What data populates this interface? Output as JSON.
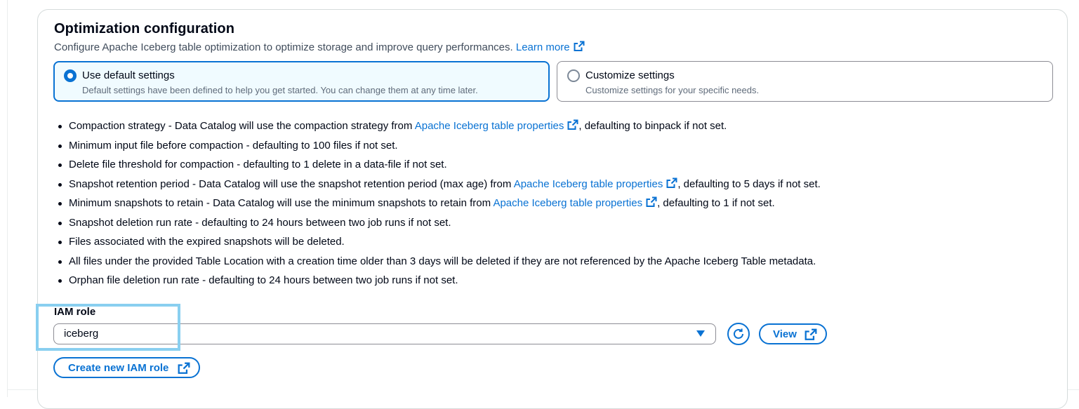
{
  "section": {
    "title": "Optimization configuration",
    "description": "Configure Apache Iceberg table optimization to optimize storage and improve query performances.",
    "learn_more": "Learn more"
  },
  "options": [
    {
      "label": "Use default settings",
      "description": "Default settings have been defined to help you get started. You can change them at any time later.",
      "selected": true
    },
    {
      "label": "Customize settings",
      "description": "Customize settings for your specific needs.",
      "selected": false
    }
  ],
  "bullets": [
    {
      "before": "Compaction strategy - Data Catalog will use the compaction strategy from ",
      "link": "Apache Iceberg table properties",
      "after": ", defaulting to binpack if not set."
    },
    {
      "before": "Minimum input file before compaction - defaulting to 100 files if not set.",
      "link": "",
      "after": ""
    },
    {
      "before": "Delete file threshold for compaction - defaulting to 1 delete in a data-file if not set.",
      "link": "",
      "after": ""
    },
    {
      "before": "Snapshot retention period - Data Catalog will use the snapshot retention period (max age) from ",
      "link": "Apache Iceberg table properties",
      "after": ", defaulting to 5 days if not set."
    },
    {
      "before": "Minimum snapshots to retain - Data Catalog will use the minimum snapshots to retain from ",
      "link": "Apache Iceberg table properties",
      "after": ", defaulting to 1 if not set."
    },
    {
      "before": "Snapshot deletion run rate - defaulting to 24 hours between two job runs if not set.",
      "link": "",
      "after": ""
    },
    {
      "before": "Files associated with the expired snapshots will be deleted.",
      "link": "",
      "after": ""
    },
    {
      "before": "All files under the provided Table Location with a creation time older than 3 days will be deleted if they are not referenced by the Apache Iceberg Table metadata.",
      "link": "",
      "after": ""
    },
    {
      "before": "Orphan file deletion run rate - defaulting to 24 hours between two job runs if not set.",
      "link": "",
      "after": ""
    }
  ],
  "iam": {
    "label": "IAM role",
    "selected_value": "iceberg",
    "view_label": "View",
    "create_label": "Create new IAM role"
  },
  "icons": {
    "external_link": "external-link-icon",
    "refresh": "refresh-icon",
    "dropdown": "caret-down-icon"
  },
  "colors": {
    "accent": "#0972d3",
    "selected_tile_bg": "#f0fbff",
    "highlight": "#89cff0"
  }
}
